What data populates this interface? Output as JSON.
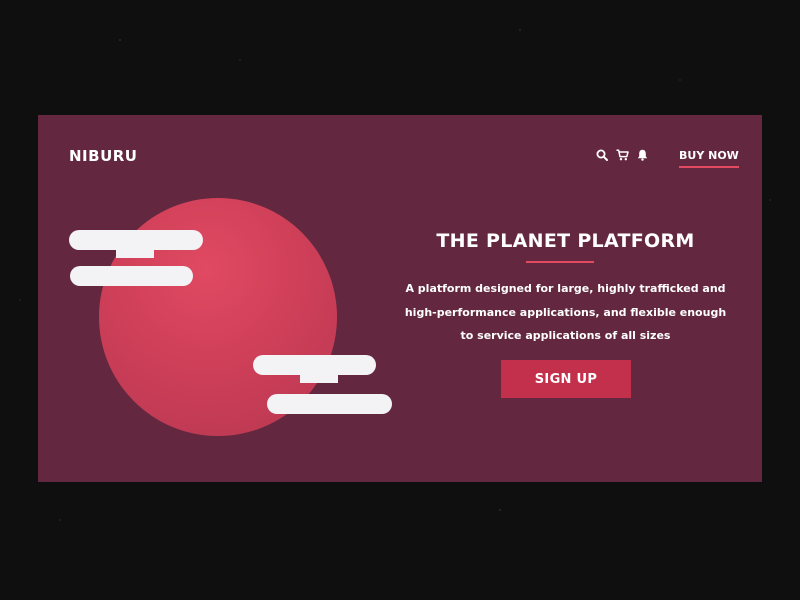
{
  "header": {
    "brand": "NIBURU",
    "icons": [
      "search-icon",
      "cart-icon",
      "bell-icon"
    ],
    "cta_label": "BUY NOW"
  },
  "hero": {
    "title": "THE PLANET PLATFORM",
    "description_lines": [
      "A platform designed for large, highly trafficked and",
      "high-performance applications, and flexible enough",
      "to service applications of all sizes"
    ],
    "button_label": "SIGN UP"
  },
  "colors": {
    "background": "#0f0f10",
    "card": "#63283f",
    "planet": "#d3425b",
    "accent": "#e14a60",
    "button": "#c3304b",
    "cloud": "#f3f2f4"
  }
}
